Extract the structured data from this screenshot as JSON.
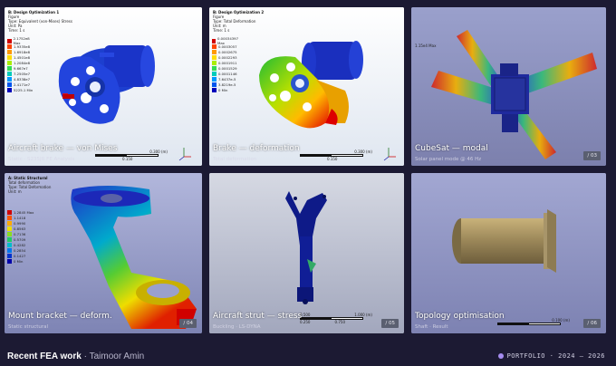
{
  "cards": [
    {
      "caption": "Aircraft brake — von Mises",
      "subtitle": "Static · S235JR FE Analysis",
      "header": {
        "title": "B: Design Optimization 1",
        "line2": "Figure",
        "line3": "Type: Equivalent (von-Mises) Stress",
        "line4": "Unit: Pa",
        "line5": "Time: 1 s"
      },
      "legend_max": "2.1752e8 Max",
      "legend_min": "5225.1 Min",
      "legend_values": [
        "1.9335e8",
        "1.6918e8",
        "1.4501e8",
        "1.2084e8",
        "9.667e7",
        "7.2505e7",
        "4.8338e7",
        "2.4171e7"
      ],
      "scale_label": "0.300 (m)",
      "scale_mid": "0.150"
    },
    {
      "caption": "Brake — deformation",
      "subtitle": "Total deformation",
      "header": {
        "title": "B: Design Optimization 2",
        "line2": "Figure",
        "line3": "Type: Total Deformation",
        "line4": "Unit: m",
        "line5": "Time: 1 s"
      },
      "legend_max": "0.00034397 Max",
      "legend_min": "0 Min",
      "legend_values": [
        "0.0003057",
        "0.0002675",
        "0.0002293",
        "0.0001911",
        "0.0001529",
        "0.0001146",
        "7.6437e-5",
        "3.8219e-5"
      ],
      "scale_label": "0.300 (m)",
      "scale_mid": "0.150"
    },
    {
      "caption": "CubeSat — modal",
      "subtitle": "Solar panel mode @ 46 Hz",
      "badge": "/ 03",
      "legend_max": "1.15e4 Max"
    },
    {
      "caption": "Mount bracket — deform.",
      "subtitle": "Static structural",
      "badge": "/ 04",
      "header": {
        "title": "A: Static Structural",
        "line2": "Total deformation",
        "line3": "Type: Total Deformation",
        "line4": "Unit: m",
        "line5": ""
      },
      "legend_max": "1.2845 Max",
      "legend_min": "0 Min",
      "legend_values": [
        "1.1418",
        "0.9990",
        "0.8563",
        "0.7136",
        "0.5709",
        "0.4282",
        "0.2854",
        "0.1427"
      ]
    },
    {
      "caption": "Aircraft strut — stress",
      "subtitle": "Buckling · LS-DYNA",
      "badge": "/ 05",
      "scale_label": "1.000 (m)",
      "scale_mid1": "0.500",
      "scale_mid2": "0.250",
      "scale_mid3": "0.750"
    },
    {
      "caption": "Topology optimisation",
      "subtitle": "Shaft · Result",
      "badge": "/ 06",
      "scale_label": "0.100 (m)"
    }
  ],
  "footer": {
    "title": "Recent FEA work",
    "author": "· Taimoor Amin",
    "right": "PORTFOLIO · 2024 — 2026"
  },
  "colors": {
    "background": "#1c1a33",
    "accent": "#a58cf0"
  }
}
